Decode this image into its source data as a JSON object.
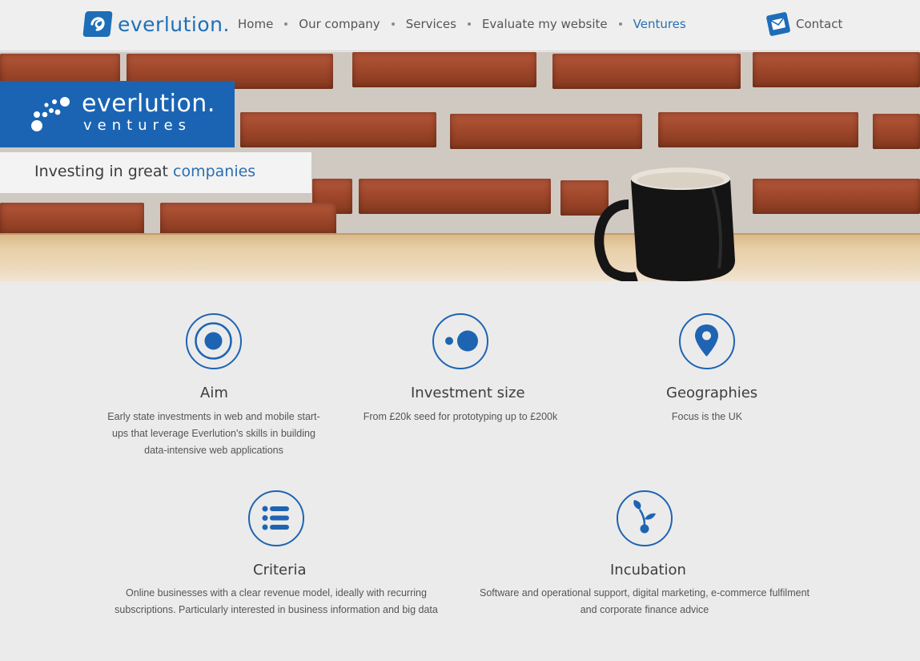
{
  "header": {
    "logo_text": "everlution.",
    "nav": [
      {
        "label": "Home",
        "active": false
      },
      {
        "label": "Our company",
        "active": false
      },
      {
        "label": "Services",
        "active": false
      },
      {
        "label": "Evaluate my website",
        "active": false
      },
      {
        "label": "Ventures",
        "active": true
      }
    ],
    "contact_label": "Contact"
  },
  "hero": {
    "brand_title": "everlution.",
    "brand_sub": "ventures",
    "tagline_prefix": "Investing in great ",
    "tagline_accent": "companies"
  },
  "features": [
    {
      "title": "Aim",
      "desc": "Early state investments in web and mobile start-ups that leverage Everlution's skills in building data-intensive web applications",
      "icon": "target-icon"
    },
    {
      "title": "Investment size",
      "desc": "From £20k seed for prototyping up to £200k",
      "icon": "dots-icon"
    },
    {
      "title": "Geographies",
      "desc": "Focus is the UK",
      "icon": "location-pin-icon"
    },
    {
      "title": "Criteria",
      "desc": "Online businesses with a clear revenue model, ideally with recurring subscriptions. Particularly interested in business information and big data",
      "icon": "list-icon"
    },
    {
      "title": "Incubation",
      "desc": "Software and operational support, digital marketing, e-commerce fulfilment and corporate finance advice",
      "icon": "sprout-icon"
    }
  ],
  "colors": {
    "accent": "#1e64b2",
    "text": "#555555"
  }
}
